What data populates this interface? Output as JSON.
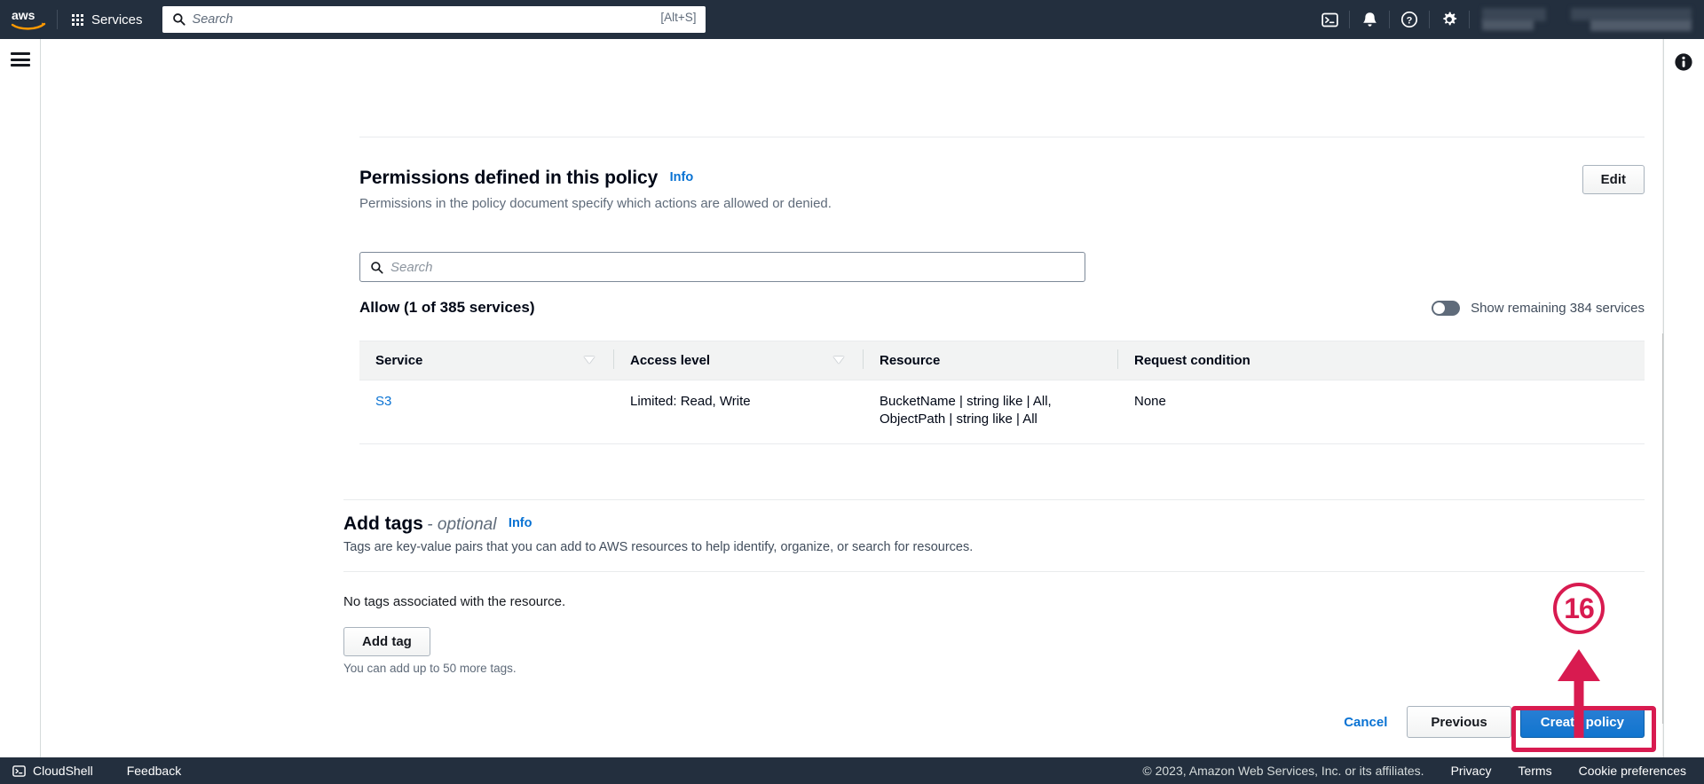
{
  "topnav": {
    "logo_alt": "aws",
    "services_label": "Services",
    "search_placeholder": "Search",
    "search_value": "",
    "search_shortcut": "[Alt+S]",
    "icons": [
      "cloudshell-icon",
      "notifications-bell-icon",
      "help-question-icon",
      "settings-gear-icon"
    ],
    "region_menu": "",
    "account_menu": ""
  },
  "permissions": {
    "title": "Permissions defined in this policy",
    "info_label": "Info",
    "description": "Permissions in the policy document specify which actions are allowed or denied.",
    "edit_label": "Edit",
    "search_placeholder": "Search",
    "search_value": "",
    "allow_label": "Allow (1 of 385 services)",
    "toggle_label": "Show remaining 384 services",
    "toggle_on": false,
    "columns": [
      "Service",
      "Access level",
      "Resource",
      "Request condition"
    ],
    "rows": [
      {
        "service": "S3",
        "access_level": "Limited: Read, Write",
        "resource_line1": "BucketName | string like | All,",
        "resource_line2": "ObjectPath | string like | All",
        "request_condition": "None"
      }
    ]
  },
  "tags": {
    "title": "Add tags",
    "optional": "- optional",
    "info_label": "Info",
    "description": "Tags are key-value pairs that you can add to AWS resources to help identify, organize, or search for resources.",
    "empty_text": "No tags associated with the resource.",
    "add_tag_label": "Add tag",
    "hint": "You can add up to 50 more tags."
  },
  "actions": {
    "cancel_label": "Cancel",
    "previous_label": "Previous",
    "create_label": "Create policy"
  },
  "annotation": {
    "step_number": "16",
    "color": "#d81b50"
  },
  "footer": {
    "cloudshell_label": "CloudShell",
    "feedback_label": "Feedback",
    "copyright": "© 2023, Amazon Web Services, Inc. or its affiliates.",
    "links": [
      "Privacy",
      "Terms",
      "Cookie preferences"
    ]
  }
}
